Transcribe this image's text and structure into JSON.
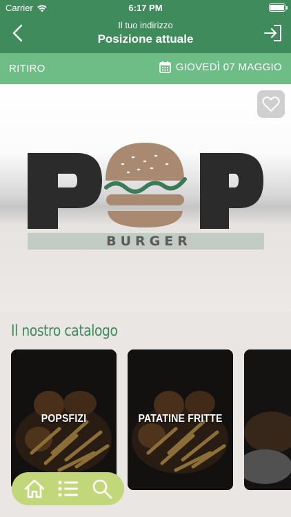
{
  "status_bar": {
    "carrier": "Carrier",
    "time": "6:17 PM"
  },
  "nav": {
    "subtitle": "Il tuo indirizzo",
    "title": "Posizione attuale"
  },
  "pickup": {
    "mode": "RITIRO",
    "date": "GIOVEDÌ 07 MAGGIO"
  },
  "brand": {
    "letter_left": "P",
    "letter_right": "P",
    "sub": "BURGER"
  },
  "catalog": {
    "title": "Il nostro catalogo",
    "items": [
      {
        "label": "POPSFIZI"
      },
      {
        "label": "PATATINE FRITTE"
      },
      {
        "label": ""
      }
    ]
  },
  "tabs": [
    {
      "icon": "home-icon"
    },
    {
      "icon": "list-icon"
    },
    {
      "icon": "search-icon"
    }
  ],
  "colors": {
    "header": "#3f8b5c",
    "pickup_bar": "#6fbd86",
    "catalog_title": "#3f8b5c",
    "tabbar": "#c2d77a"
  }
}
